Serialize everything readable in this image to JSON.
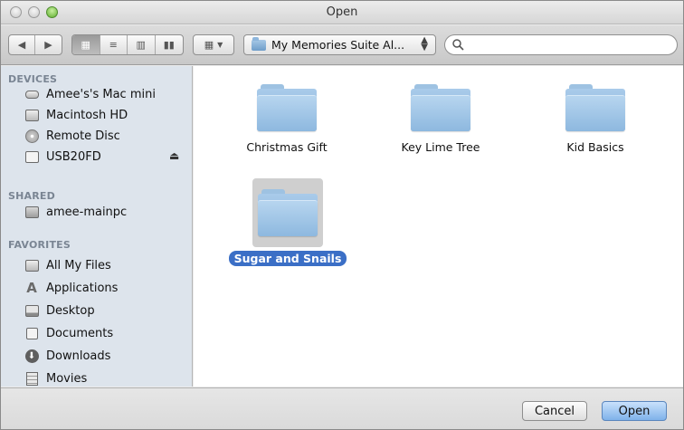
{
  "window": {
    "title": "Open"
  },
  "toolbar": {
    "back_icon": "chevron-left-icon",
    "forward_icon": "chevron-right-icon",
    "location": "My Memories Suite Al...",
    "search_placeholder": "",
    "search_value": ""
  },
  "sidebar": {
    "devices_header": "DEVICES",
    "devices": [
      {
        "label": "Amee's's Mac mini",
        "icon": "mac-mini-icon"
      },
      {
        "label": "Macintosh HD",
        "icon": "hard-drive-icon"
      },
      {
        "label": "Remote Disc",
        "icon": "disc-icon"
      },
      {
        "label": "USB20FD",
        "icon": "usb-drive-icon"
      }
    ],
    "shared_header": "SHARED",
    "shared": [
      {
        "label": "amee-mainpc",
        "icon": "network-computer-icon"
      }
    ],
    "favorites_header": "FAVORITES",
    "favorites": [
      {
        "label": "All My Files",
        "icon": "all-files-icon"
      },
      {
        "label": "Applications",
        "icon": "applications-icon"
      },
      {
        "label": "Desktop",
        "icon": "desktop-icon"
      },
      {
        "label": "Documents",
        "icon": "documents-icon"
      },
      {
        "label": "Downloads",
        "icon": "downloads-icon"
      },
      {
        "label": "Movies",
        "icon": "movies-icon"
      }
    ]
  },
  "content": {
    "items": [
      {
        "name": "Christmas Gift",
        "selected": false
      },
      {
        "name": "Key Lime Tree",
        "selected": false
      },
      {
        "name": "Kid Basics",
        "selected": false
      },
      {
        "name": "Sugar and Snails",
        "selected": true
      }
    ]
  },
  "footer": {
    "cancel_label": "Cancel",
    "open_label": "Open"
  },
  "colors": {
    "sidebar_bg": "#dde4ec",
    "selection": "#3b6fc6",
    "default_button": "#7fb2ea"
  }
}
